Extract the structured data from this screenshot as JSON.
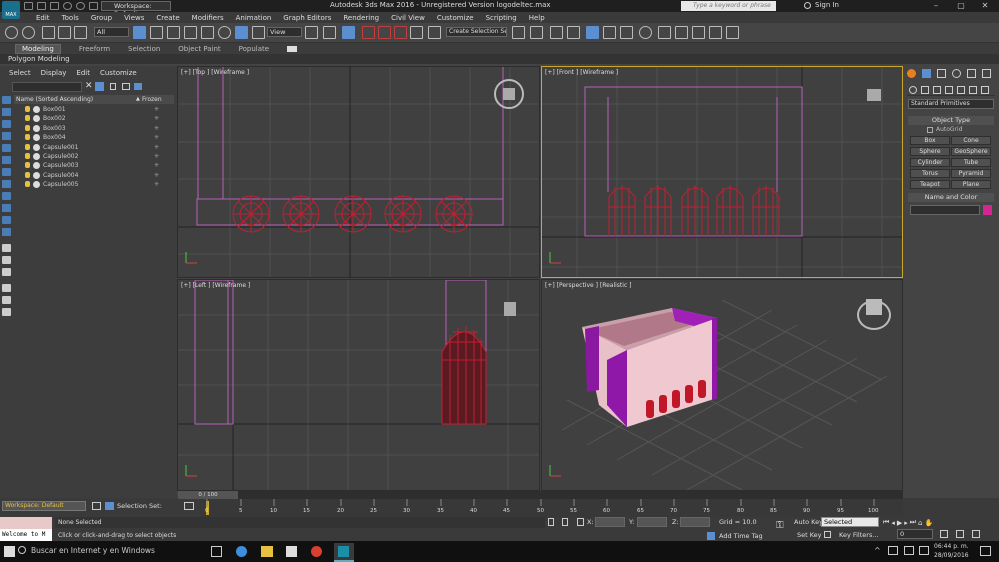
{
  "window": {
    "title": "Autodesk 3ds Max 2016 - Unregistered Version    logodeltec.max",
    "logo_text": "MAX",
    "search_placeholder": "Type a keyword or phrase",
    "sign_in": "Sign In",
    "workspace": "Workspace: Default"
  },
  "menu": [
    "Edit",
    "Tools",
    "Group",
    "Views",
    "Create",
    "Modifiers",
    "Animation",
    "Graph Editors",
    "Rendering",
    "Civil View",
    "Customize",
    "Scripting",
    "Help"
  ],
  "toolbar": {
    "filter": "All",
    "ref_coord": "View",
    "selection_set": "Create Selection Se"
  },
  "ribbon": {
    "tabs": [
      "Modeling",
      "Freeform",
      "Selection",
      "Object Paint",
      "Populate"
    ],
    "sub": "Polygon Modeling"
  },
  "scene": {
    "menu": [
      "Select",
      "Display",
      "Edit",
      "Customize"
    ],
    "col_name": "Name (Sorted Ascending)",
    "col_frozen": "Frozen",
    "objects": [
      "Box001",
      "Box002",
      "Box003",
      "Box004",
      "Capsule001",
      "Capsule002",
      "Capsule003",
      "Capsule004",
      "Capsule005"
    ]
  },
  "viewports": {
    "top": "[+] [Top ] [Wireframe ]",
    "front": "[+] [Front ] [Wireframe ]",
    "left": "[+] [Left ] [Wireframe ]",
    "persp": "[+] [Perspective ] [Realistic ]"
  },
  "command": {
    "dropdown": "Standard Primitives",
    "rollout_object": "Object Type",
    "autogrid": "AutoGrid",
    "buttons": [
      "Box",
      "Cone",
      "Sphere",
      "GeoSphere",
      "Cylinder",
      "Tube",
      "Torus",
      "Pyramid",
      "Teapot",
      "Plane"
    ],
    "rollout_name": "Name and Color",
    "object_color": "#d02890"
  },
  "timeline": {
    "frame": "0 / 100",
    "ticks": [
      "0",
      "5",
      "10",
      "15",
      "20",
      "25",
      "30",
      "35",
      "40",
      "45",
      "50",
      "55",
      "60",
      "65",
      "70",
      "75",
      "80",
      "85",
      "90",
      "95",
      "100"
    ]
  },
  "status": {
    "workspace": "Workspace: Default",
    "selection_set": "Selection Set:",
    "selected": "None Selected",
    "prompt": "Click or click-and-drag to select objects",
    "welcome": "Welcome to M",
    "x": "X:",
    "y": "Y:",
    "z": "Z:",
    "grid": "Grid = 10.0",
    "add_time_tag": "Add Time Tag",
    "auto_key": "Auto Key",
    "set_key": "Set Key",
    "key_mode": "Selected",
    "key_filters": "Key Filters...",
    "frame_value": "0"
  },
  "taskbar": {
    "search": "Buscar en Internet y en Windows",
    "time": "06:44 p. m.",
    "date": "28/09/2016"
  },
  "colors": {
    "accent": "#c9a82a",
    "wire": "#c02030",
    "box": "#b860b8",
    "persp_box": "#e8c0c8",
    "persp_side": "#8a18a0"
  }
}
